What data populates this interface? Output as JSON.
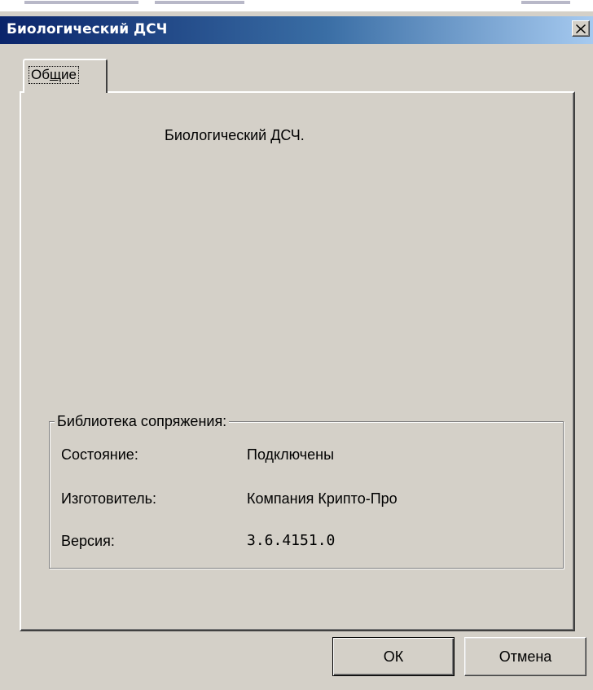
{
  "window": {
    "title": "Биологический ДСЧ"
  },
  "tabs": [
    {
      "label_prefix": "Об",
      "label_accel": "щ",
      "label_suffix": "ие",
      "selected": true
    }
  ],
  "panel": {
    "description": "Биологический ДСЧ.",
    "group": {
      "legend": "Библиотека сопряжения:",
      "rows": [
        {
          "label": "Состояние:",
          "value": "Подключены"
        },
        {
          "label": "Изготовитель:",
          "value": "Компания Крипто-Про"
        },
        {
          "label": "Версия:",
          "value": "3.6.4151.0"
        }
      ]
    }
  },
  "buttons": {
    "ok": "ОК",
    "cancel": "Отмена"
  },
  "icons": {
    "close": "close-icon"
  },
  "colors": {
    "face": "#d4d0c8",
    "title_start": "#0a246a",
    "title_end": "#a6caf0"
  }
}
